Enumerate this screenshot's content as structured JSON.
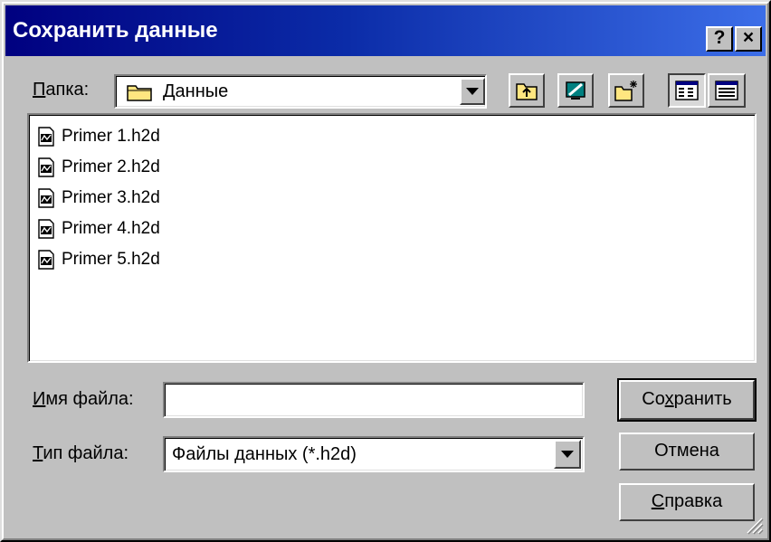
{
  "window": {
    "title": "Сохранить данные",
    "help_glyph": "?",
    "close_glyph": "×"
  },
  "folder": {
    "label_underlined": "П",
    "label_rest": "апка:",
    "current": "Данные",
    "icon": "folder-icon"
  },
  "toolbar": {
    "buttons": [
      {
        "name": "up-one-level-button",
        "icon": "folder-up-icon"
      },
      {
        "name": "desktop-button",
        "icon": "desktop-icon"
      },
      {
        "name": "new-folder-button",
        "icon": "new-folder-icon"
      },
      {
        "name": "list-view-button",
        "icon": "list-view-icon"
      },
      {
        "name": "details-view-button",
        "icon": "details-view-icon"
      }
    ]
  },
  "files": [
    {
      "name": "Primer 1.h2d",
      "icon": "data-file-icon"
    },
    {
      "name": "Primer 2.h2d",
      "icon": "data-file-icon"
    },
    {
      "name": "Primer 3.h2d",
      "icon": "data-file-icon"
    },
    {
      "name": "Primer 4.h2d",
      "icon": "data-file-icon"
    },
    {
      "name": "Primer 5.h2d",
      "icon": "data-file-icon"
    }
  ],
  "filename": {
    "label_underlined": "И",
    "label_rest": "мя файла:",
    "value": ""
  },
  "filetype": {
    "label_underlined": "Т",
    "label_rest": "ип файла:",
    "value": "Файлы данных (*.h2d)"
  },
  "buttons": {
    "save_pre": "Со",
    "save_u": "х",
    "save_post": "ранить",
    "cancel": "Отмена",
    "help_u": "С",
    "help_post": "правка"
  },
  "colors": {
    "titlebar_start": "#000080",
    "titlebar_end": "#3c6ee8",
    "face": "#c0c0c0"
  }
}
